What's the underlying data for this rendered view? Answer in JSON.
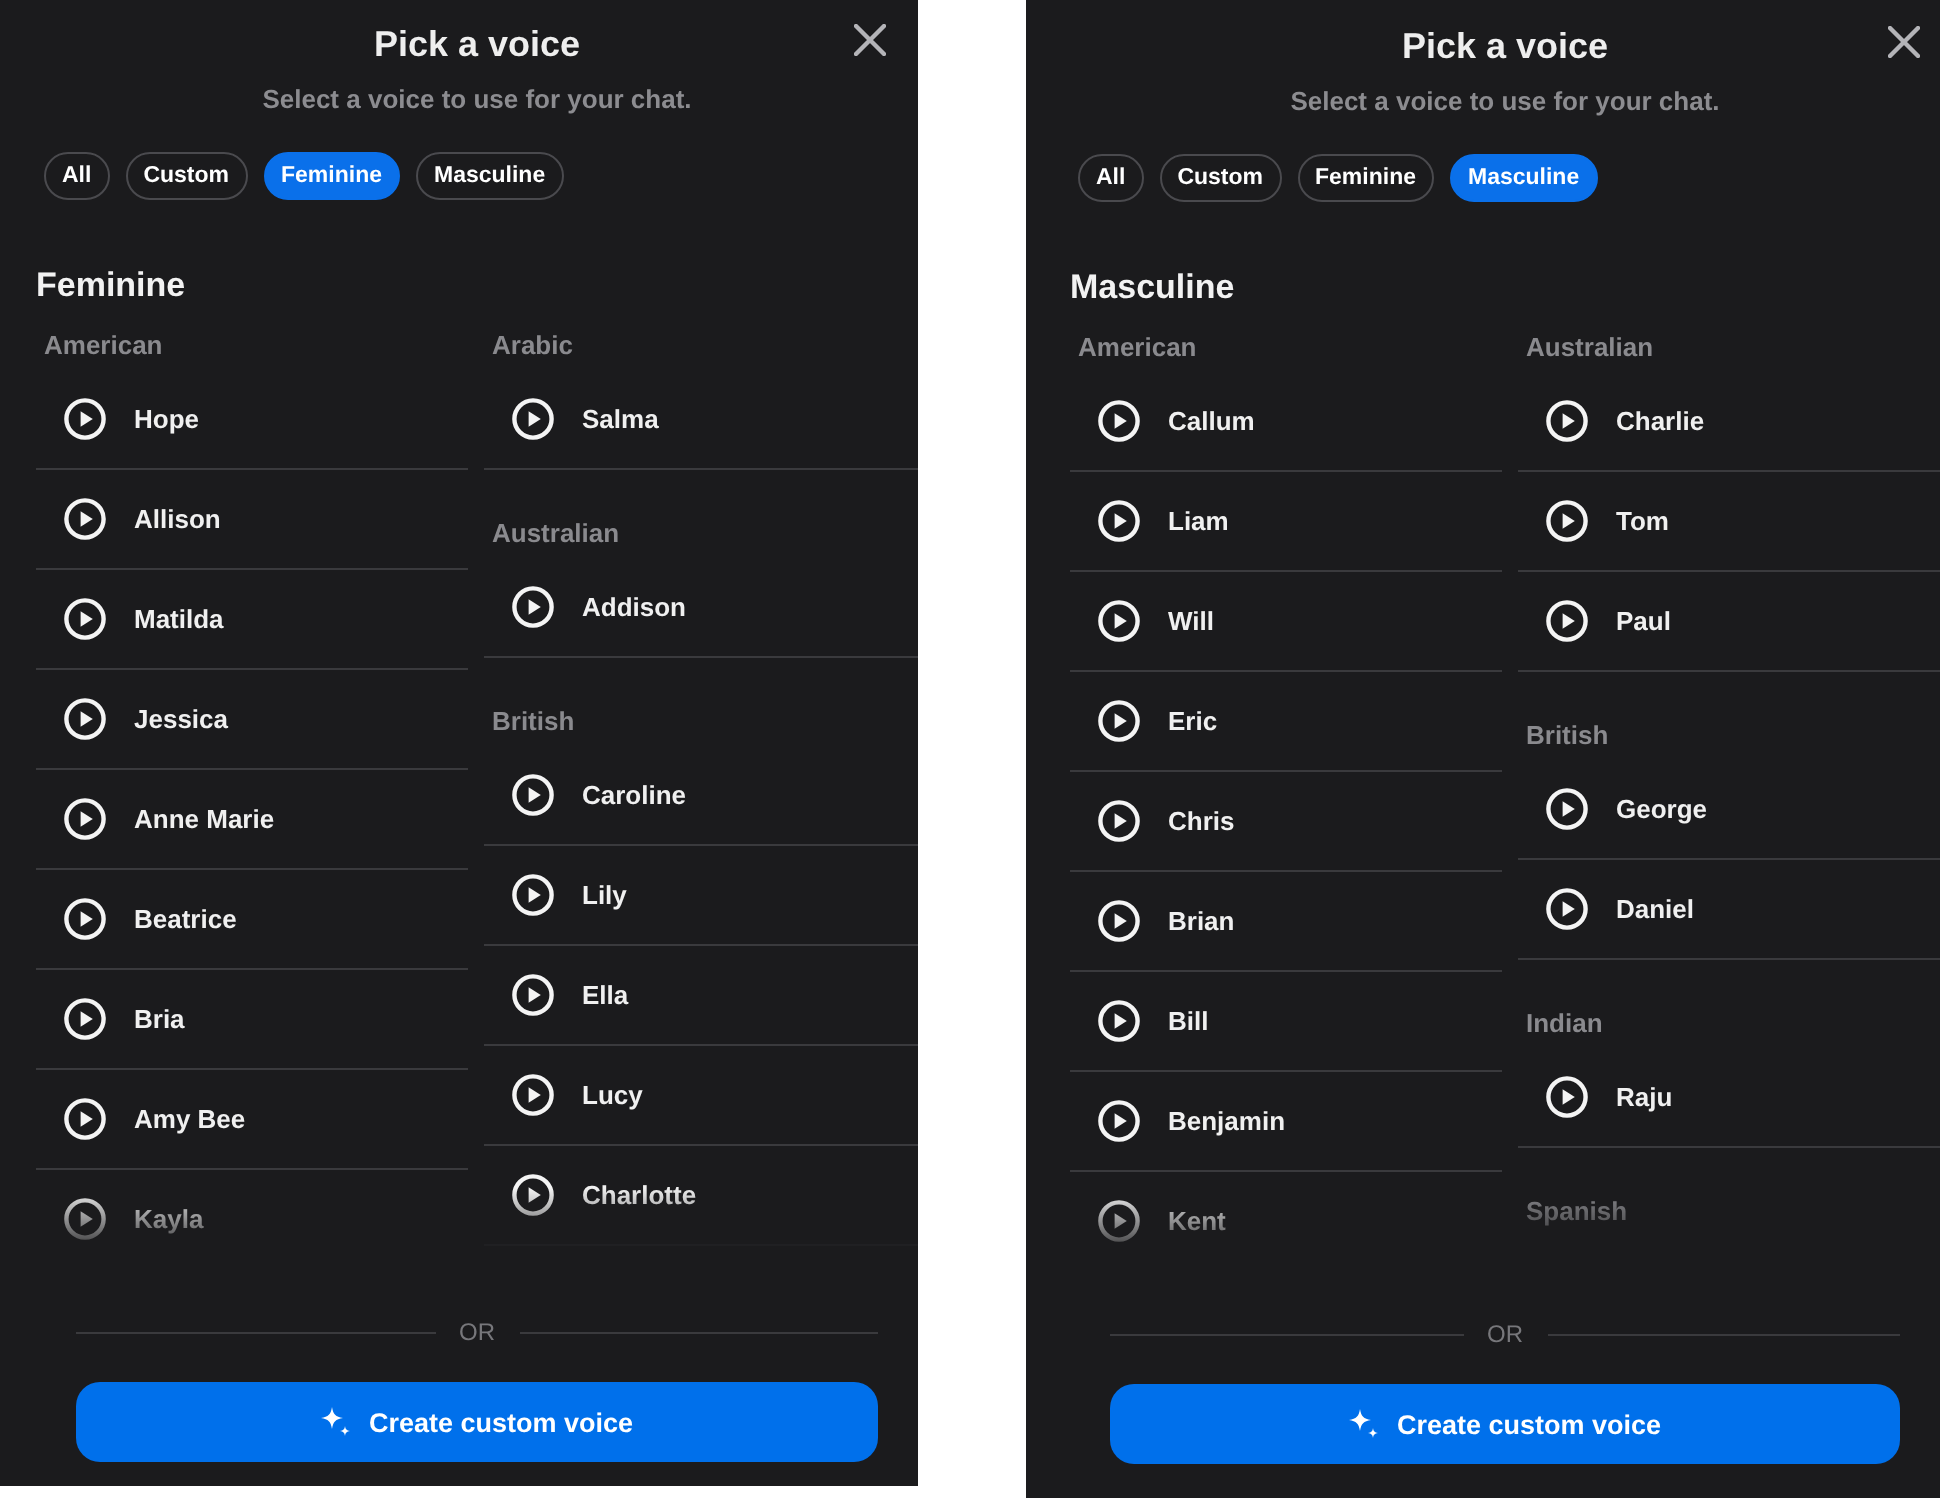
{
  "panels": [
    {
      "title": "Pick a voice",
      "subtitle": "Select a voice to use for your chat.",
      "filters": [
        {
          "label": "All",
          "selected": false
        },
        {
          "label": "Custom",
          "selected": false
        },
        {
          "label": "Feminine",
          "selected": true
        },
        {
          "label": "Masculine",
          "selected": false
        }
      ],
      "section_title": "Feminine",
      "columns": [
        {
          "groups": [
            {
              "label": "American",
              "voices": [
                "Hope",
                "Allison",
                "Matilda",
                "Jessica",
                "Anne Marie",
                "Beatrice",
                "Bria",
                "Amy Bee",
                "Kayla"
              ]
            }
          ]
        },
        {
          "groups": [
            {
              "label": "Arabic",
              "voices": [
                "Salma"
              ]
            },
            {
              "label": "Australian",
              "voices": [
                "Addison"
              ]
            },
            {
              "label": "British",
              "voices": [
                "Caroline",
                "Lily",
                "Ella",
                "Lucy",
                "Charlotte"
              ]
            }
          ]
        }
      ],
      "divider_label": "OR",
      "create_button": {
        "label": "Create custom voice"
      }
    },
    {
      "title": "Pick a voice",
      "subtitle": "Select a voice to use for your chat.",
      "filters": [
        {
          "label": "All",
          "selected": false
        },
        {
          "label": "Custom",
          "selected": false
        },
        {
          "label": "Feminine",
          "selected": false
        },
        {
          "label": "Masculine",
          "selected": true
        }
      ],
      "section_title": "Masculine",
      "columns": [
        {
          "groups": [
            {
              "label": "American",
              "voices": [
                "Callum",
                "Liam",
                "Will",
                "Eric",
                "Chris",
                "Brian",
                "Bill",
                "Benjamin",
                "Kent"
              ]
            }
          ]
        },
        {
          "groups": [
            {
              "label": "Australian",
              "voices": [
                "Charlie",
                "Tom",
                "Paul"
              ]
            },
            {
              "label": "British",
              "voices": [
                "George",
                "Daniel"
              ]
            },
            {
              "label": "Indian",
              "voices": [
                "Raju"
              ]
            },
            {
              "label": "Spanish"
            }
          ]
        }
      ],
      "divider_label": "OR",
      "create_button": {
        "label": "Create custom voice"
      }
    }
  ]
}
